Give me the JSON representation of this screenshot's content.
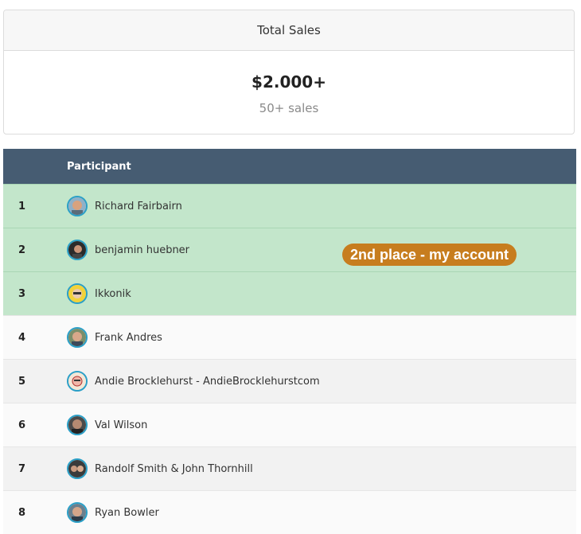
{
  "summary": {
    "title": "Total Sales",
    "amount": "$2.000+",
    "sales_count": "50+ sales"
  },
  "table": {
    "header": {
      "participant": "Participant"
    },
    "rows": [
      {
        "rank": "1",
        "name": "Richard Fairbairn",
        "avatar": "avatar-icon"
      },
      {
        "rank": "2",
        "name": "benjamin huebner",
        "avatar": "avatar-icon"
      },
      {
        "rank": "3",
        "name": "Ikkonik",
        "avatar": "avatar-icon"
      },
      {
        "rank": "4",
        "name": "Frank Andres",
        "avatar": "avatar-icon"
      },
      {
        "rank": "5",
        "name": "Andie Brocklehurst - AndieBrocklehurstcom",
        "avatar": "avatar-icon"
      },
      {
        "rank": "6",
        "name": "Val Wilson",
        "avatar": "avatar-icon"
      },
      {
        "rank": "7",
        "name": "Randolf Smith & John Thornhill",
        "avatar": "avatar-icon"
      },
      {
        "rank": "8",
        "name": "Ryan Bowler",
        "avatar": "avatar-icon"
      }
    ]
  },
  "annotation": {
    "label": "2nd place - my account"
  },
  "colors": {
    "header_bg": "#465c72",
    "top3_bg": "#c3e6cb",
    "badge_bg": "#c77d1e",
    "avatar_ring": "#2a9fc7"
  }
}
